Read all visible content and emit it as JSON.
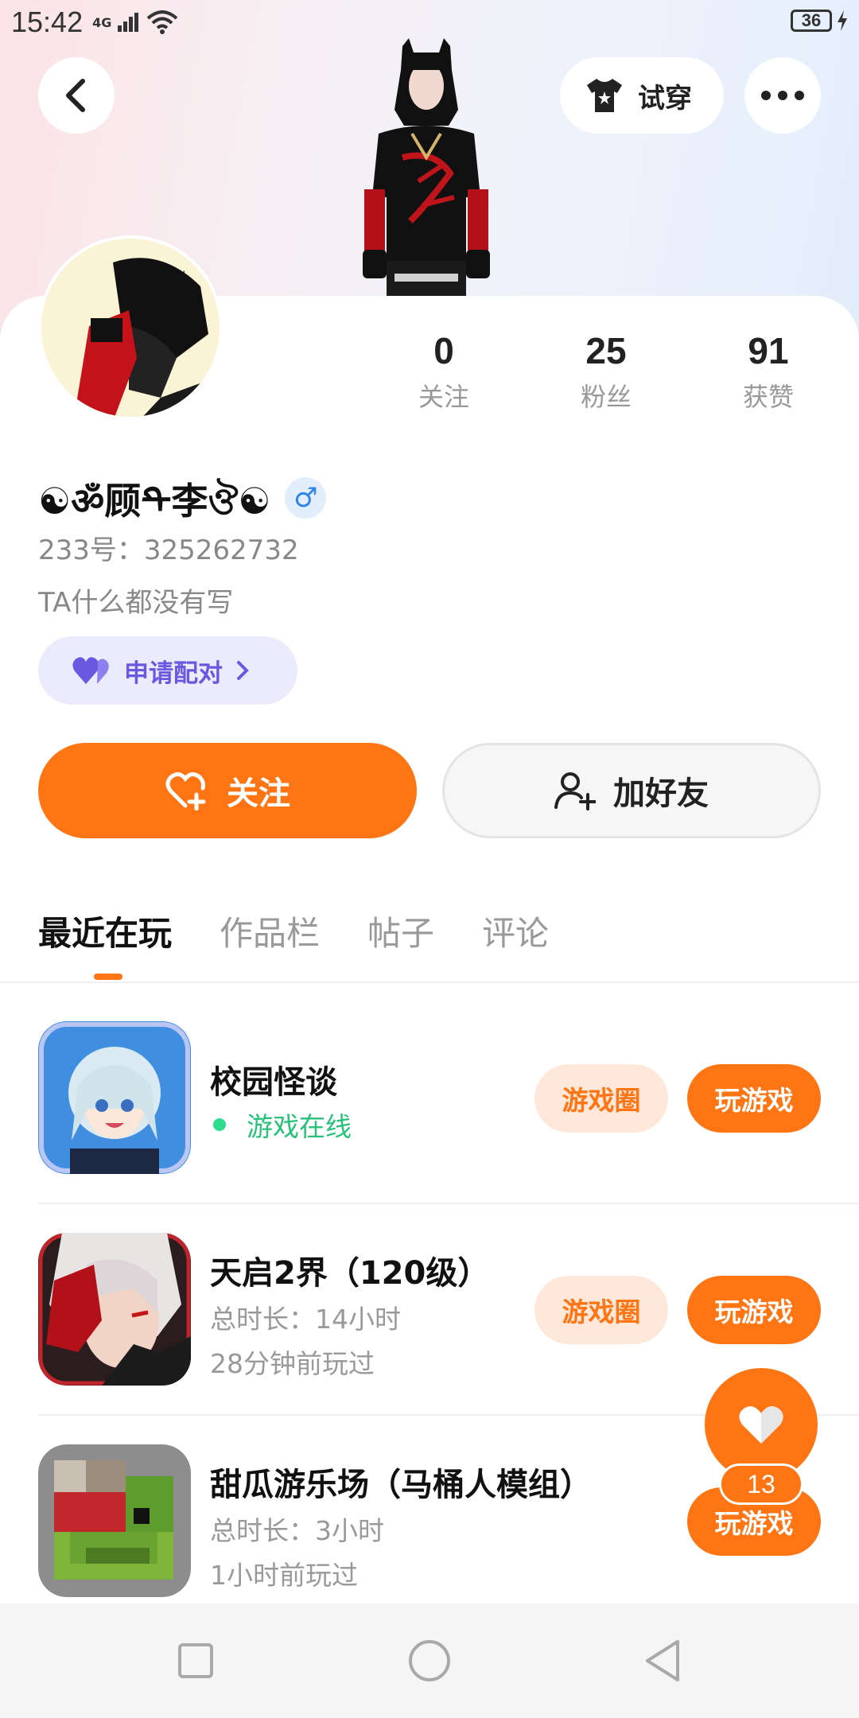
{
  "status_bar": {
    "time": "15:42",
    "network": "4G",
    "battery": "36"
  },
  "header": {
    "try_on_label": "试穿"
  },
  "profile": {
    "nickname": "☯ॐ顾ᡨ李ঔ☯",
    "id_line": "233号：325262732",
    "bio": "TA什么都没有写",
    "pair_label": "申请配对",
    "gender_symbol": "♂"
  },
  "stats": [
    {
      "value": "0",
      "label": "关注"
    },
    {
      "value": "25",
      "label": "粉丝"
    },
    {
      "value": "91",
      "label": "获赞"
    }
  ],
  "actions": {
    "follow_label": "关注",
    "add_friend_label": "加好友"
  },
  "tabs": [
    {
      "label": "最近在玩",
      "active": true
    },
    {
      "label": "作品栏",
      "active": false
    },
    {
      "label": "帖子",
      "active": false
    },
    {
      "label": "评论",
      "active": false
    }
  ],
  "games": [
    {
      "title": "校园怪谈",
      "status": "游戏在线",
      "circle_label": "游戏圈",
      "play_label": "玩游戏"
    },
    {
      "title": "天启2界（120级）",
      "duration": "总时长：14小时",
      "last_played": "28分钟前玩过",
      "circle_label": "游戏圈",
      "play_label": "玩游戏"
    },
    {
      "title": "甜瓜游乐场（马桶人模组）",
      "duration": "总时长：3小时",
      "last_played": "1小时前玩过",
      "play_label": "玩游戏"
    }
  ],
  "fab": {
    "count": "13"
  },
  "colors": {
    "accent": "#ff7514",
    "accent_light": "#ffe8da",
    "pair_purple": "#6a58e0",
    "online_green": "#27c27a"
  }
}
